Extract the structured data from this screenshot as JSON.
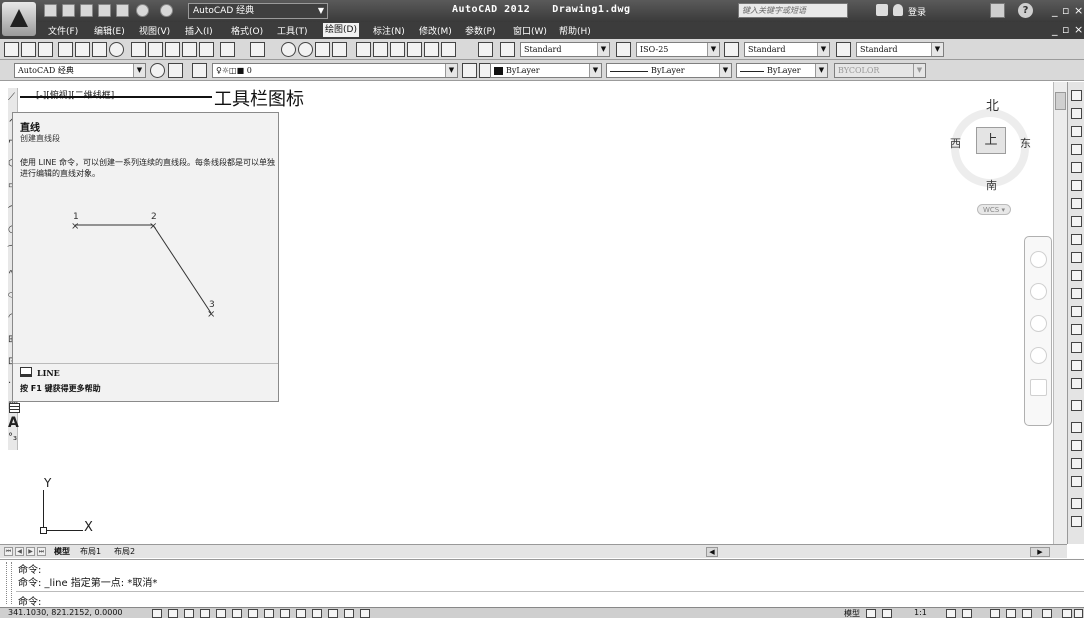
{
  "title_bar": {
    "app_name": "AutoCAD 2012",
    "document": "Drawing1.dwg",
    "workspace": "AutoCAD 经典",
    "search_placeholder": "键入关键字或短语",
    "login": "登录"
  },
  "menu": {
    "items": [
      "文件(F)",
      "编辑(E)",
      "视图(V)",
      "插入(I)",
      "格式(O)",
      "工具(T)",
      "绘图(D)",
      "标注(N)",
      "修改(M)",
      "参数(P)",
      "窗口(W)",
      "帮助(H)"
    ],
    "active_index": 6
  },
  "toolbars": {
    "text_style": "Standard",
    "dim_style": "ISO-25",
    "table_style": "Standard",
    "mleader_style": "Standard",
    "workspace_combo": "AutoCAD 经典",
    "layer_combo": "0",
    "color_combo": "ByLayer",
    "linetype_combo": "ByLayer",
    "lineweight_combo": "ByLayer",
    "plotstyle_combo": "BYCOLOR"
  },
  "viewport": {
    "label": "[-][俯视][二维线框]",
    "callout": "工具栏图标"
  },
  "tooltip": {
    "title": "直线",
    "subtitle": "创建直线段",
    "description": "使用 LINE 命令，可以创建一系列连续的直线段。每条线段都是可以单独进行编辑的直线对象。",
    "points": [
      "1",
      "2",
      "3"
    ],
    "command": "LINE",
    "help": "按 F1 键获得更多帮助"
  },
  "viewcube": {
    "north": "北",
    "south": "南",
    "east": "东",
    "west": "西",
    "face": "上",
    "wcs": "WCS"
  },
  "ucs": {
    "x": "X",
    "y": "Y"
  },
  "layout_tabs": [
    "模型",
    "布局1",
    "布局2"
  ],
  "command_window": {
    "lines": [
      "命令:",
      "命令: _line 指定第一点: *取消*",
      "命令:"
    ]
  },
  "status_bar": {
    "coordinates": "341.1030, 821.2152, 0.0000",
    "model": "模型",
    "scale": "1:1"
  },
  "colors": {
    "title_bar": "#3a3a3a",
    "menu_bar": "#3c3c3c",
    "toolbar": "#d9d9d9",
    "canvas": "#ffffff",
    "tooltip": "#f2f2f2"
  }
}
